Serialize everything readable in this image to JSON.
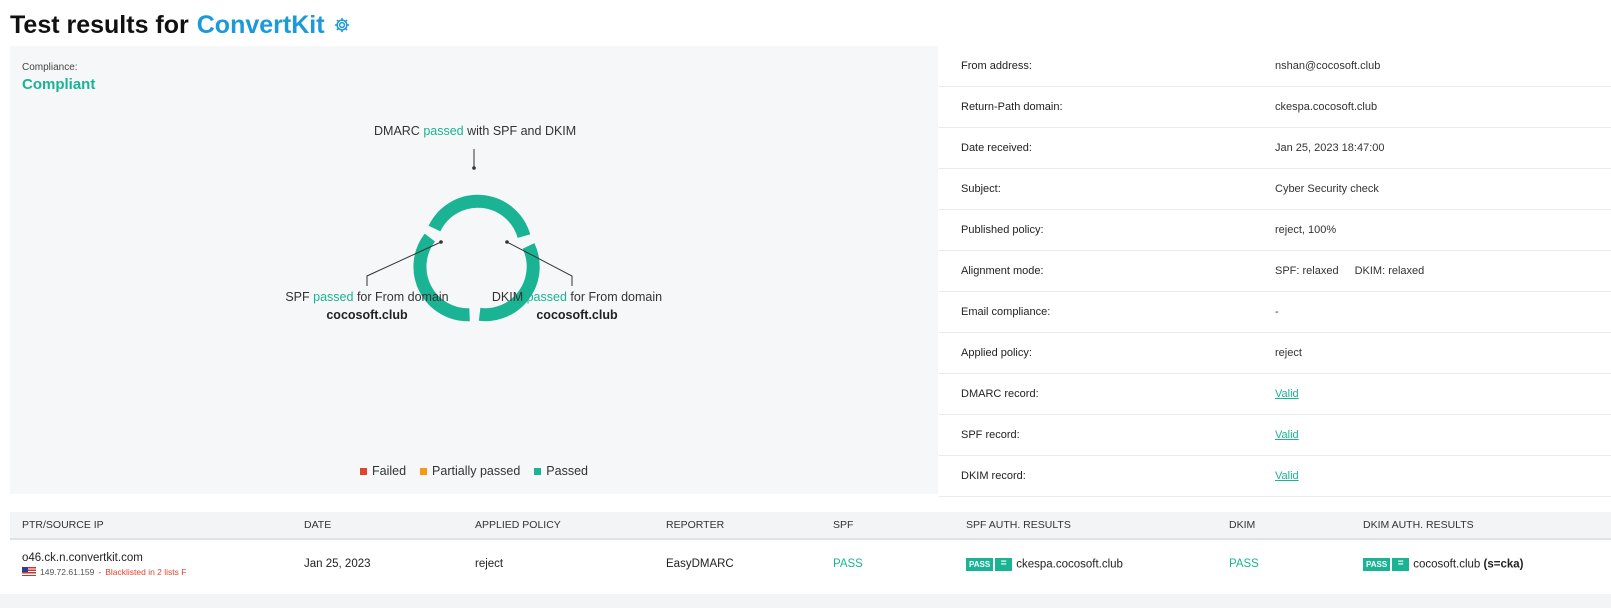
{
  "header": {
    "title_prefix": "Test results for",
    "brand": "ConvertKit"
  },
  "compliance": {
    "label": "Compliance:",
    "value": "Compliant"
  },
  "diagram": {
    "dmarc": {
      "pre": "DMARC",
      "status": "passed",
      "post": "with SPF and DKIM"
    },
    "spf": {
      "pre": "SPF",
      "status": "passed",
      "post": "for From domain",
      "domain": "cocosoft.club"
    },
    "dkim": {
      "pre": "DKIM",
      "status": "passed",
      "post": "for From domain",
      "domain": "cocosoft.club"
    },
    "ring_color": "#1ab394"
  },
  "legend": [
    {
      "label": "Failed",
      "color": "#e0442c"
    },
    {
      "label": "Partially passed",
      "color": "#f39c12"
    },
    {
      "label": "Passed",
      "color": "#1ab394"
    }
  ],
  "details": [
    {
      "key": "From address:",
      "value": "nshan@cocosoft.club"
    },
    {
      "key": "Return-Path domain:",
      "value": "ckespa.cocosoft.club"
    },
    {
      "key": "Date received:",
      "value": "Jan 25, 2023 18:47:00"
    },
    {
      "key": "Subject:",
      "value": "Cyber Security check"
    },
    {
      "key": "Published policy:",
      "value": "reject, 100%"
    },
    {
      "key": "Alignment mode:",
      "value": "SPF: relaxed",
      "value2": "DKIM: relaxed"
    },
    {
      "key": "Email compliance:",
      "value": "-"
    },
    {
      "key": "Applied policy:",
      "value": "reject"
    },
    {
      "key": "DMARC record:",
      "value": "Valid",
      "link": true
    },
    {
      "key": "SPF record:",
      "value": "Valid",
      "link": true
    },
    {
      "key": "DKIM record:",
      "value": "Valid",
      "link": true
    }
  ],
  "table": {
    "columns": [
      "PTR/SOURCE IP",
      "DATE",
      "APPLIED POLICY",
      "REPORTER",
      "SPF",
      "SPF AUTH. RESULTS",
      "DKIM",
      "DKIM AUTH. RESULTS"
    ],
    "row": {
      "ptr": "o46.ck.n.convertkit.com",
      "ip": "149.72.61.159",
      "sep": "-",
      "blacklist": "Blacklisted in 2 lists F",
      "date": "Jan 25, 2023",
      "policy": "reject",
      "reporter": "EasyDMARC",
      "spf": "PASS",
      "spf_badge": "PASS",
      "spf_eq": "=",
      "spf_domain": "ckespa.cocosoft.club",
      "dkim": "PASS",
      "dkim_badge": "PASS",
      "dkim_eq": "=",
      "dkim_domain": "cocosoft.club",
      "dkim_selector": "(s=cka)"
    }
  }
}
